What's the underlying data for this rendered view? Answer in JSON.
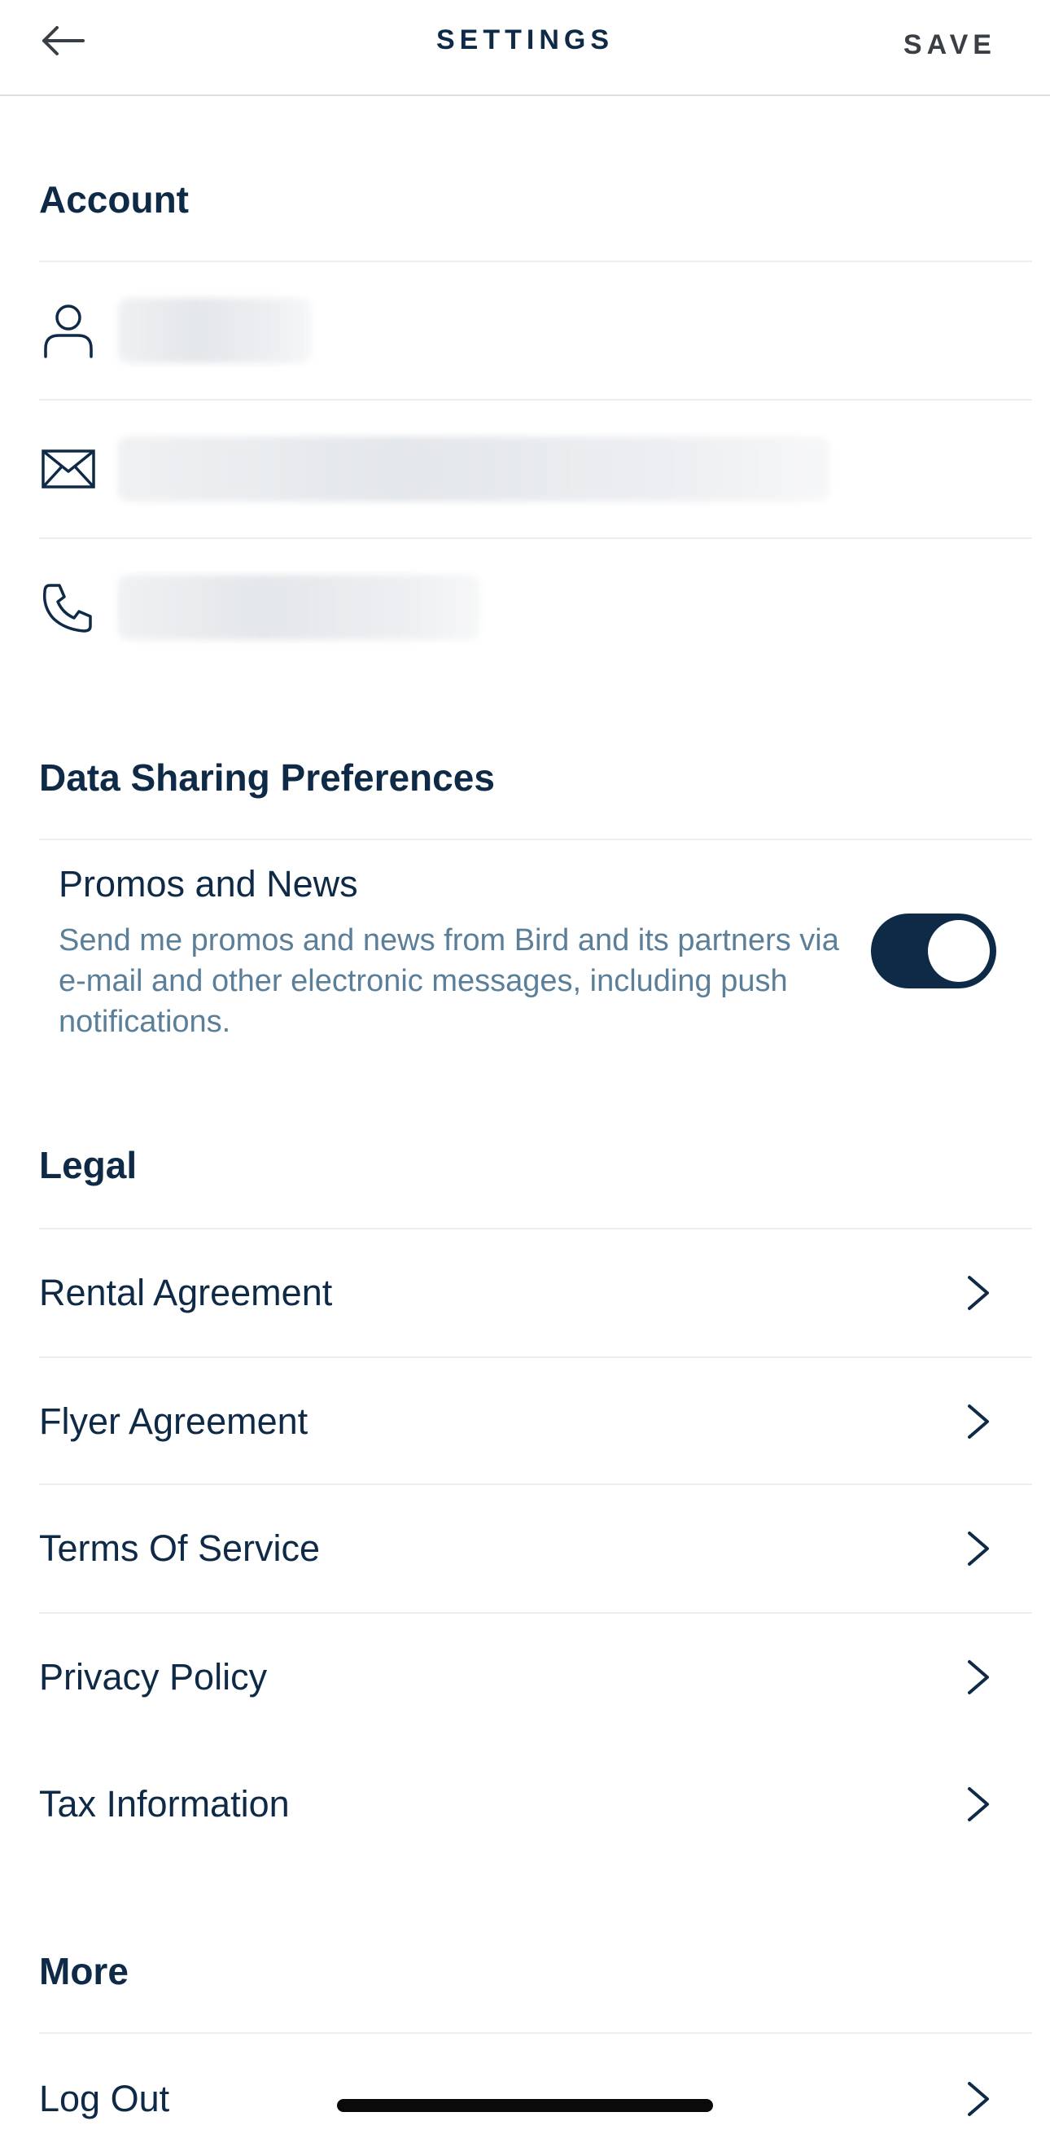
{
  "nav": {
    "title": "SETTINGS",
    "save_label": "SAVE"
  },
  "account": {
    "header": "Account",
    "rows": [
      {
        "icon": "person-icon",
        "value": ""
      },
      {
        "icon": "mail-icon",
        "value": ""
      },
      {
        "icon": "phone-icon",
        "value": ""
      }
    ]
  },
  "data_sharing": {
    "header": "Data Sharing Preferences",
    "promo_title": "Promos and News",
    "promo_desc": "Send me promos and news from Bird and its partners via e-mail and other electronic messages, including push notifications.",
    "toggle_on": true
  },
  "legal": {
    "header": "Legal",
    "items": [
      {
        "label": "Rental Agreement"
      },
      {
        "label": "Flyer Agreement"
      },
      {
        "label": "Terms Of Service"
      },
      {
        "label": "Privacy Policy"
      },
      {
        "label": "Tax Information"
      }
    ]
  },
  "more": {
    "header": "More",
    "items": [
      {
        "label": "Log Out"
      }
    ]
  },
  "colors": {
    "primary": "#0e2a47",
    "secondary_text": "#5b7f99",
    "divider": "#eceef0"
  }
}
